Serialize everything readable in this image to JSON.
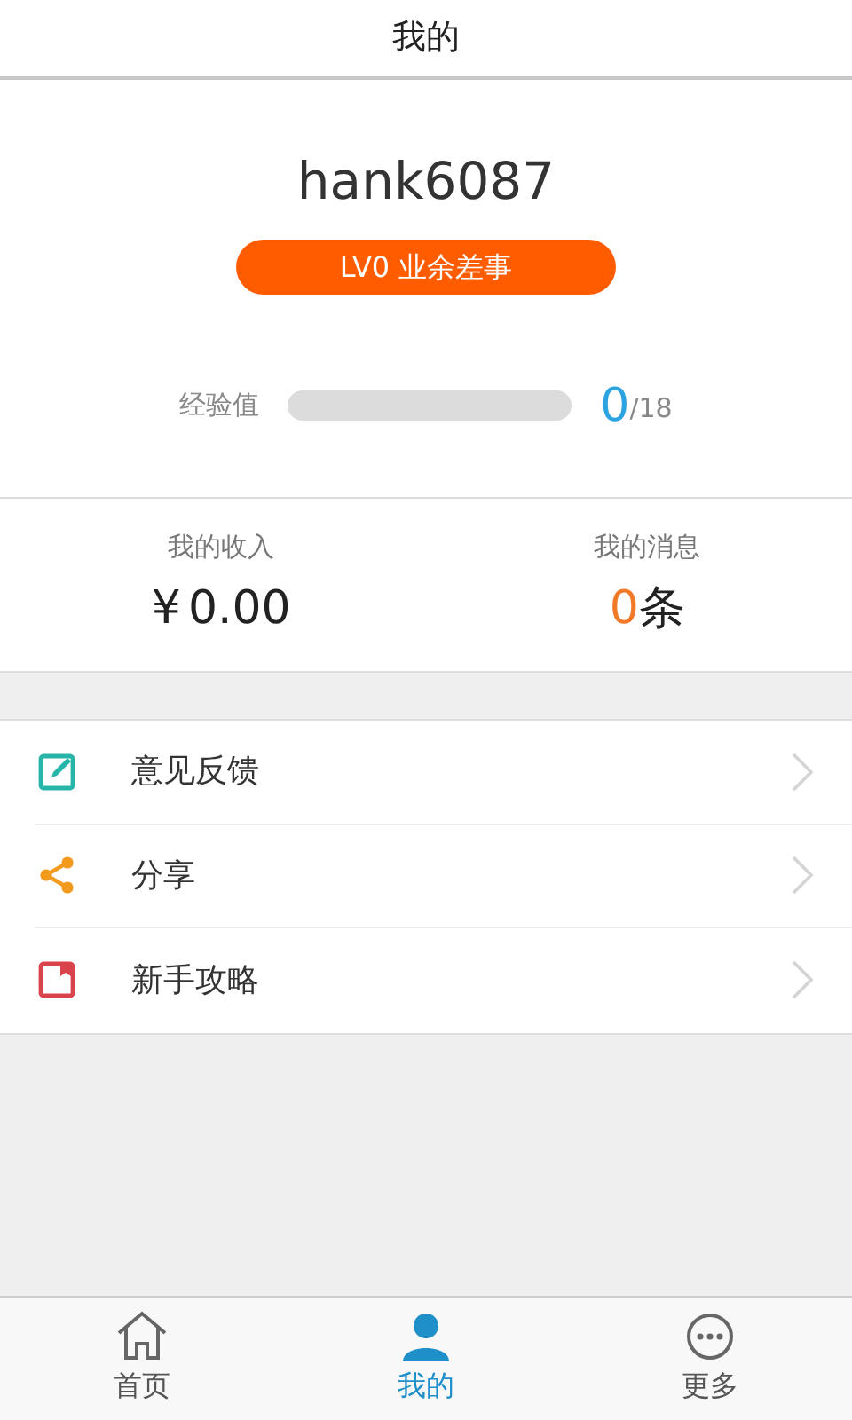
{
  "header": {
    "title": "我的"
  },
  "profile": {
    "username": "hank6087",
    "level_badge": "LV0 业余差事",
    "experience": {
      "label": "经验值",
      "level": 0,
      "current": "0",
      "total": "/18"
    }
  },
  "stats": [
    {
      "label": "我的收入",
      "value_prefix": "¥",
      "value": "0.00"
    },
    {
      "label": "我的消息",
      "value": "0",
      "value_suffix": "条"
    }
  ],
  "menu": [
    {
      "kind": "edit",
      "label": "意见反馈",
      "color": "#26b5a8"
    },
    {
      "kind": "share",
      "label": "分享",
      "color": "#f29a1d"
    },
    {
      "kind": "guide",
      "label": "新手攻略",
      "color": "#d9434b"
    }
  ],
  "tabs": [
    {
      "kind": "home",
      "label": "首页",
      "selected": false
    },
    {
      "kind": "user",
      "label": "我的",
      "selected": true
    },
    {
      "kind": "more",
      "label": "更多",
      "selected": false
    }
  ]
}
